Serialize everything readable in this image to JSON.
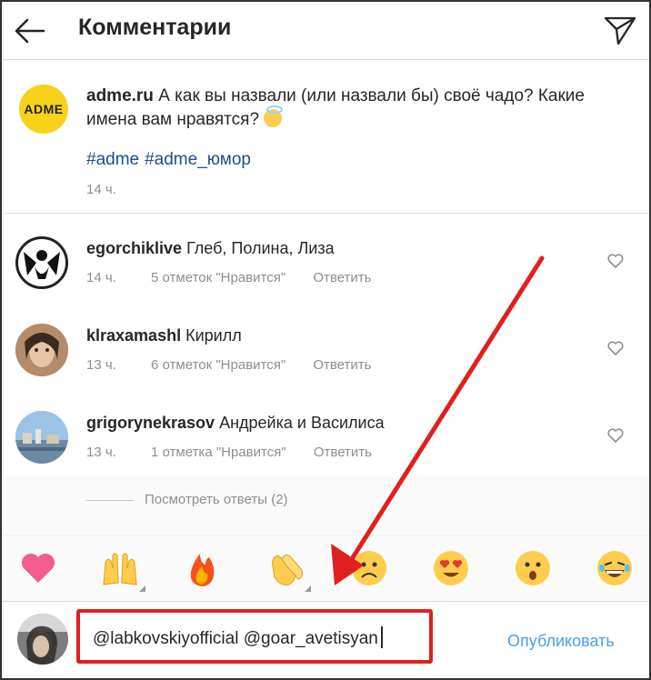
{
  "header": {
    "title": "Комментарии",
    "back_icon": "arrow-left-icon",
    "direct_icon": "paper-plane-icon"
  },
  "caption": {
    "logo_text": "ADME",
    "username": "adme.ru",
    "text": "А как вы назвали (или назвали бы) своё чадо? Какие имена вам нравятся?",
    "emoji": "angel-face-emoji",
    "hashtags": [
      "#adme",
      "#adme_юмор"
    ],
    "time": "14 ч."
  },
  "comments": [
    {
      "username": "egorchiklive",
      "text": "Глеб, Полина, Лиза",
      "time": "14 ч.",
      "likes": "5 отметок \"Нравится\"",
      "reply": "Ответить"
    },
    {
      "username": "klraxamashl",
      "text": "Кирилл",
      "time": "13 ч.",
      "likes": "6 отметок \"Нравится\"",
      "reply": "Ответить"
    },
    {
      "username": "grigorynekrasov",
      "text": "Андрейка и Василиса",
      "time": "13 ч.",
      "likes": "1 отметка \"Нравится\"",
      "reply": "Ответить"
    }
  ],
  "view_replies": "Посмотреть ответы (2)",
  "emoji_bar": [
    "heart",
    "raised-hands",
    "fire",
    "clapping-hands",
    "sad-face",
    "heart-eyes",
    "surprised-face",
    "laughing-face"
  ],
  "input": {
    "value": "@labkovskiyofficial @goar_avetisyan",
    "publish_label": "Опубликовать"
  },
  "colors": {
    "accent_blue": "#4a9fe6",
    "hashtag": "#1f4d8a",
    "annotation_red": "#e0201f",
    "adme_yellow": "#f7d21a"
  }
}
